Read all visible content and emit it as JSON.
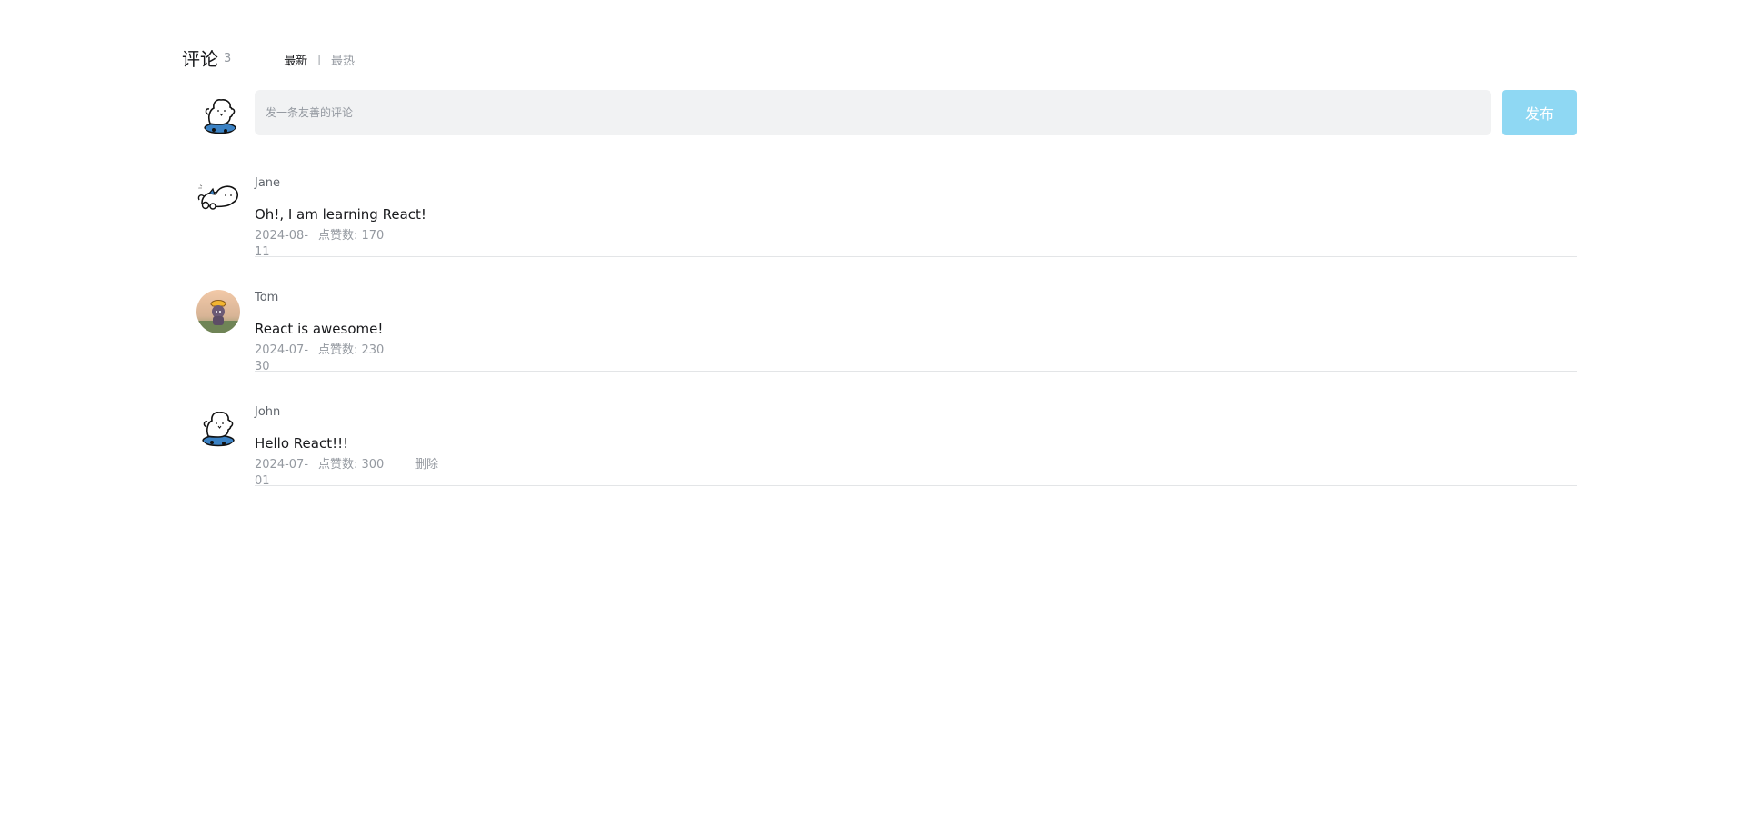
{
  "header": {
    "title": "评论",
    "count": "3",
    "sort_latest": "最新",
    "sort_separator": "|",
    "sort_hot": "最热"
  },
  "composer": {
    "placeholder": "发一条友善的评论",
    "publish_label": "发布",
    "avatar_icon": "puppy-skateboard-avatar"
  },
  "comments": [
    {
      "user": "Jane",
      "text": "Oh!, I am learning React!",
      "date": "2024-08-11",
      "likes": "点赞数: 170",
      "avatar_icon": "puppy-lying-avatar"
    },
    {
      "user": "Tom",
      "text": "React is awesome!",
      "date": "2024-07-30",
      "likes": "点赞数: 230",
      "avatar_icon": "photo-avatar"
    },
    {
      "user": "John",
      "text": "Hello React!!!",
      "date": "2024-07-01",
      "likes": "点赞数: 300",
      "delete_label": "删除",
      "avatar_icon": "puppy-skateboard-avatar"
    }
  ],
  "colors": {
    "primary_button": "#8fd8f3",
    "input_background": "#f1f2f3",
    "muted_text": "#9499a0",
    "divider": "#e3e5e7"
  }
}
